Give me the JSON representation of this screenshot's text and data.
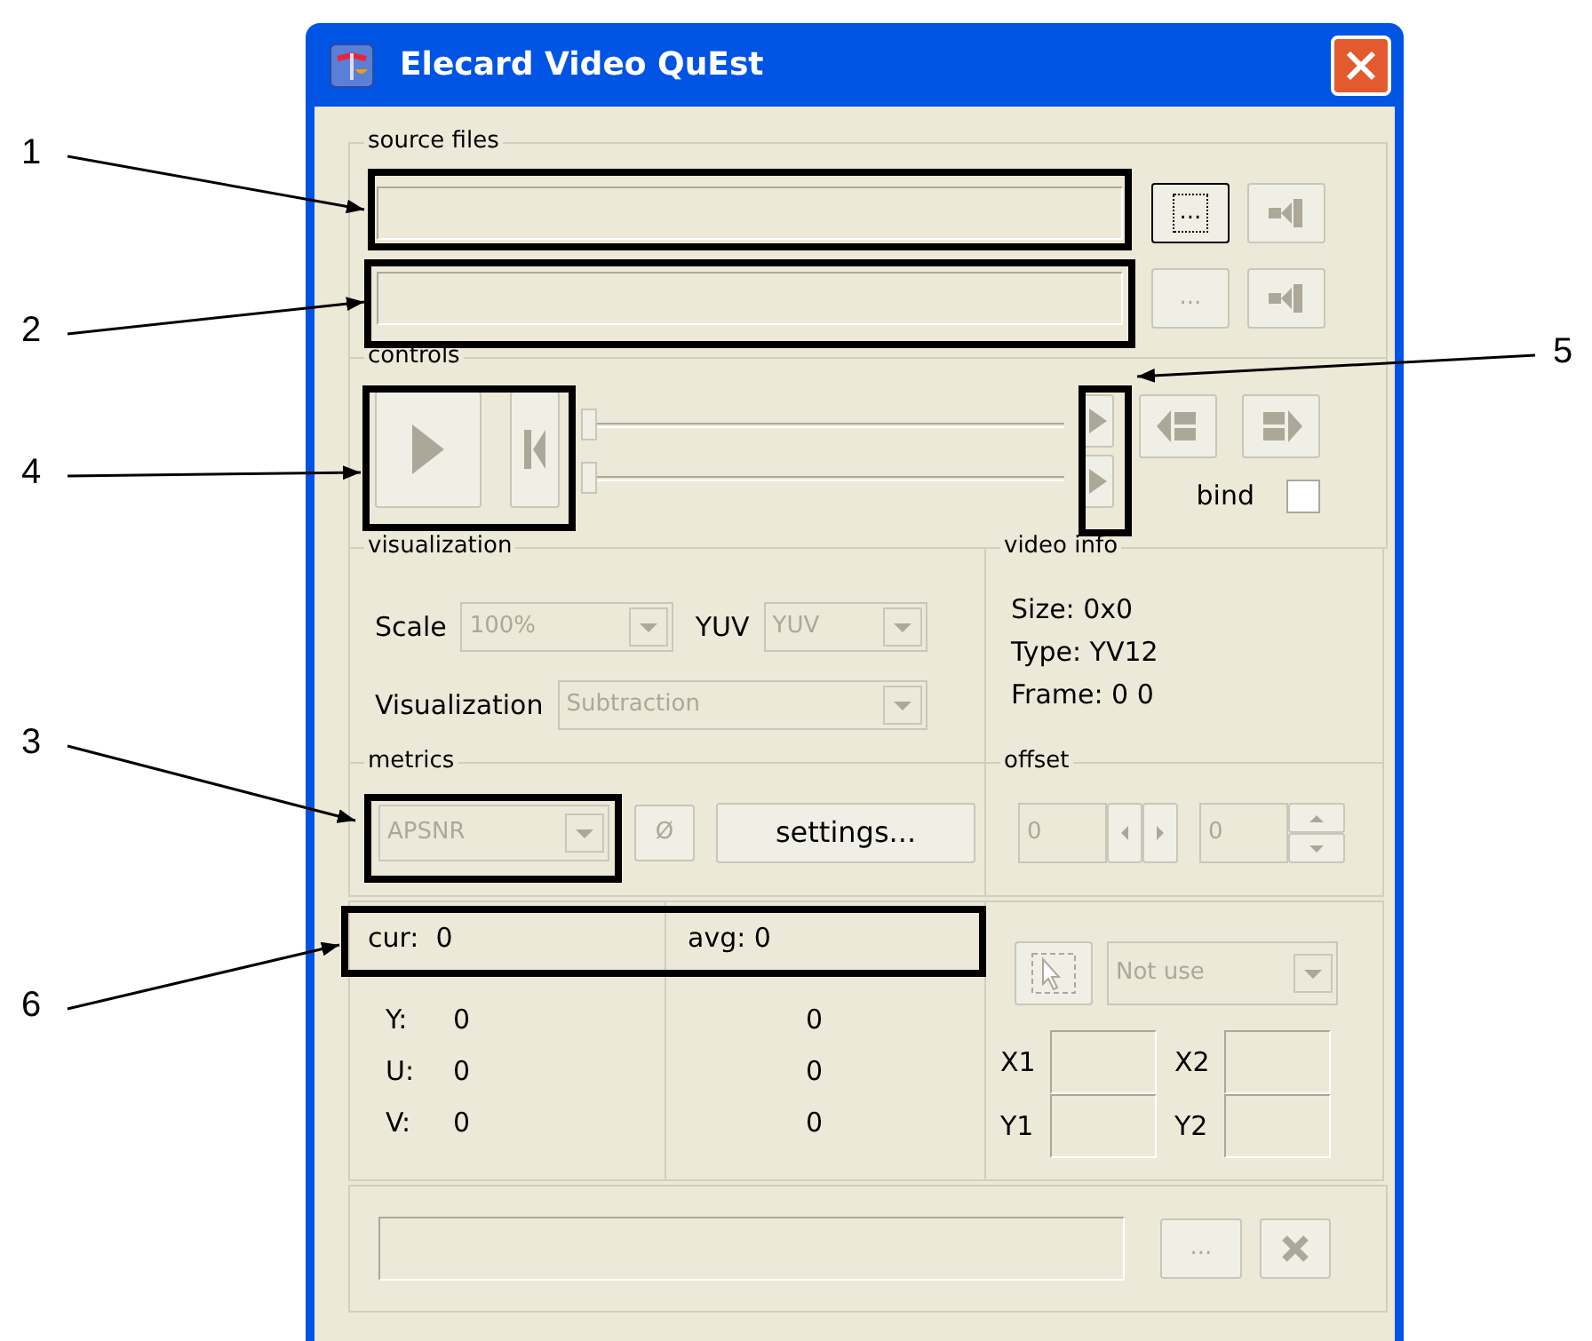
{
  "window": {
    "title": "Elecard Video QuEst"
  },
  "source_files": {
    "label": "source files",
    "rows": [
      {
        "browse": "...",
        "disabled": false
      },
      {
        "browse": "...",
        "disabled": true
      }
    ]
  },
  "controls": {
    "label": "controls",
    "sliders": [
      {
        "level": 0
      },
      {
        "level": 0
      }
    ],
    "bind": {
      "label": "bind",
      "checked": false
    }
  },
  "visualization": {
    "label": "visualization",
    "scale": {
      "label": "Scale",
      "value": "100%"
    },
    "yuv": {
      "label": "YUV",
      "value": "YUV"
    },
    "mode": {
      "label": "Visualization",
      "value": "Subtraction"
    }
  },
  "video_info": {
    "label": "video info",
    "lines": [
      "Size: 0x0",
      "Type: YV12",
      "Frame: 0 0"
    ]
  },
  "metrics": {
    "label": "metrics",
    "metric": "APSNR",
    "zero_button": "Ø",
    "settings": "settings..."
  },
  "offset": {
    "label": "offset",
    "values": [
      "0",
      "0"
    ]
  },
  "results": {
    "cur": "cur:  0",
    "avg": "avg: 0",
    "rows": [
      {
        "channel": "Y:",
        "cur": "0",
        "avg": "0"
      },
      {
        "channel": "U:",
        "cur": "0",
        "avg": "0"
      },
      {
        "channel": "V:",
        "cur": "0",
        "avg": "0"
      }
    ]
  },
  "region": {
    "mode": "Not use",
    "fields": [
      "X1",
      "X2",
      "Y1",
      "Y2"
    ]
  },
  "output": {
    "browse": "..."
  },
  "callouts": [
    {
      "number": "1"
    },
    {
      "number": "2"
    },
    {
      "number": "5"
    },
    {
      "number": "4"
    },
    {
      "number": "3"
    },
    {
      "number": "6"
    }
  ]
}
